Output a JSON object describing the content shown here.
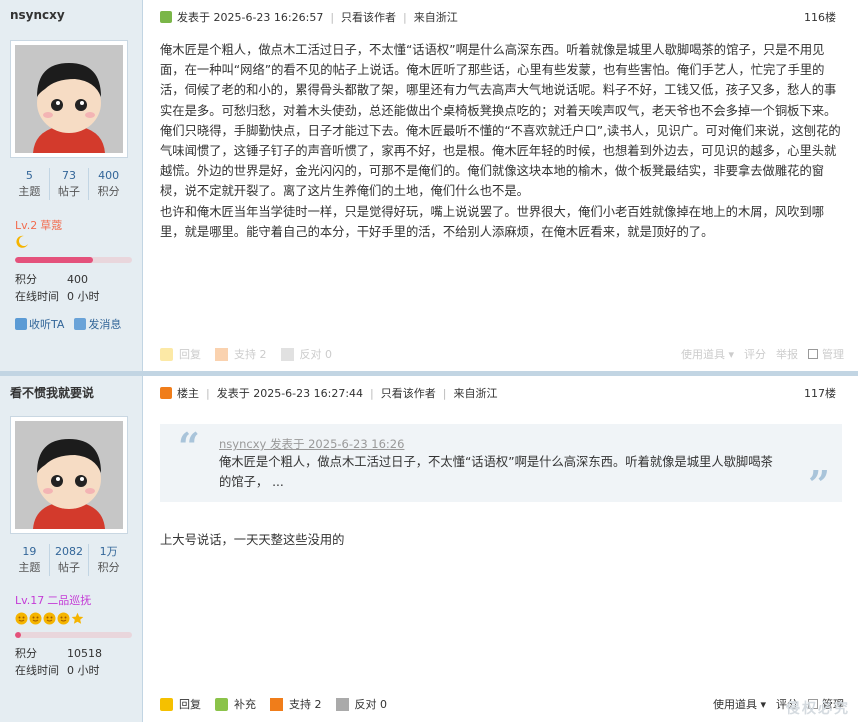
{
  "posts": [
    {
      "author": "nsyncxy",
      "stats": [
        {
          "num": "5",
          "label": "主题"
        },
        {
          "num": "73",
          "label": "帖子"
        },
        {
          "num": "400",
          "label": "积分"
        }
      ],
      "level": "Lv.2",
      "level_title": "草蔻",
      "level_icon": "moon-icon",
      "progress": 0.67,
      "credits_label": "积分",
      "credits_value": "400",
      "online_label": "在线时间",
      "online_value": "0 小时",
      "actions": [
        "收听TA",
        "发消息"
      ],
      "header": {
        "posted": "发表于 2025-6-23 16:26:57",
        "only_author": "只看该作者",
        "from": "来自浙江",
        "floor": "116楼"
      },
      "content": [
        "俺木匠是个粗人，做点木工活过日子，不太懂“话语权”啊是什么高深东西。听着就像是城里人歇脚喝茶的馆子，只是不用见面，在一种叫“网络”的看不见的帖子上说话。俺木匠听了那些话，心里有些发蒙，也有些害怕。俺们手艺人，忙完了手里的活，伺候了老的和小的，累得骨头都散了架，哪里还有力气去高声大气地说话呢。料子不好，工钱又低，孩子又多，愁人的事实在是多。可愁归愁，对着木头使劲，总还能做出个桌椅板凳换点吃的；对着天唉声叹气，老天爷也不会多掉一个铜板下来。俺们只晓得，手脚勤快点，日子才能过下去。俺木匠最听不懂的“不喜欢就迁户口”,读书人，见识广。可对俺们来说，这刨花的气味闻惯了，这锤子钉子的声音听惯了，家再不好，也是根。俺木匠年轻的时候，也想着到外边去，可见识的越多，心里头就越慌。外边的世界是好，金光闪闪的，可那不是俺们的。俺们就像这块本地的榆木，做个板凳最结实，非要拿去做雕花的窗棂，说不定就开裂了。离了这片生养俺们的土地，俺们什么也不是。",
        "也许和俺木匠当年当学徒时一样，只是觉得好玩，嘴上说说罢了。世界很大，俺们小老百姓就像掉在地上的木屑，风吹到哪里，就是哪里。能守着自己的本分，干好手里的活，不给别人添麻烦，在俺木匠看来，就是顶好的了。"
      ],
      "footer": {
        "reply": "回复",
        "support": "支持 2",
        "oppose": "反对 0",
        "tools": "使用道具",
        "rate": "评分",
        "report": "举报",
        "manage": "管理"
      }
    },
    {
      "author": "看不惯我就要说",
      "stats": [
        {
          "num": "19",
          "label": "主题"
        },
        {
          "num": "2082",
          "label": "帖子"
        },
        {
          "num": "1万",
          "label": "积分"
        }
      ],
      "level": "Lv.17",
      "level_title": "二品巡抚",
      "level_icons": [
        "sun-face-icon",
        "sun-face-icon",
        "sun-face-icon",
        "sun-face-icon",
        "star-icon"
      ],
      "progress": 0.05,
      "credits_label": "积分",
      "credits_value": "10518",
      "online_label": "在线时间",
      "online_value": "0 小时",
      "header": {
        "role": "楼主",
        "posted": "发表于 2025-6-23 16:27:44",
        "only_author": "只看该作者",
        "from": "来自浙江",
        "floor": "117楼"
      },
      "quote": {
        "head": "nsyncxy 发表于 2025-6-23 16:26",
        "text": "俺木匠是个粗人，做点木工活过日子，不太懂“话语权”啊是什么高深东西。听着就像是城里人歇脚喝茶的馆子， ..."
      },
      "reply_text": "上大号说话，一天天整这些没用的",
      "footer": {
        "reply": "回复",
        "supplement": "补充",
        "support": "支持 2",
        "oppose": "反对 0",
        "tools": "使用道具",
        "rate": "评分",
        "manage": "管理"
      }
    }
  ],
  "colors": {
    "sidebar_bg": "#e5edf2",
    "border": "#c2d5e3",
    "link": "#336699",
    "level_pink": "#f26c4f",
    "level_purple": "#c43bd6",
    "progress": "#e4527c"
  }
}
